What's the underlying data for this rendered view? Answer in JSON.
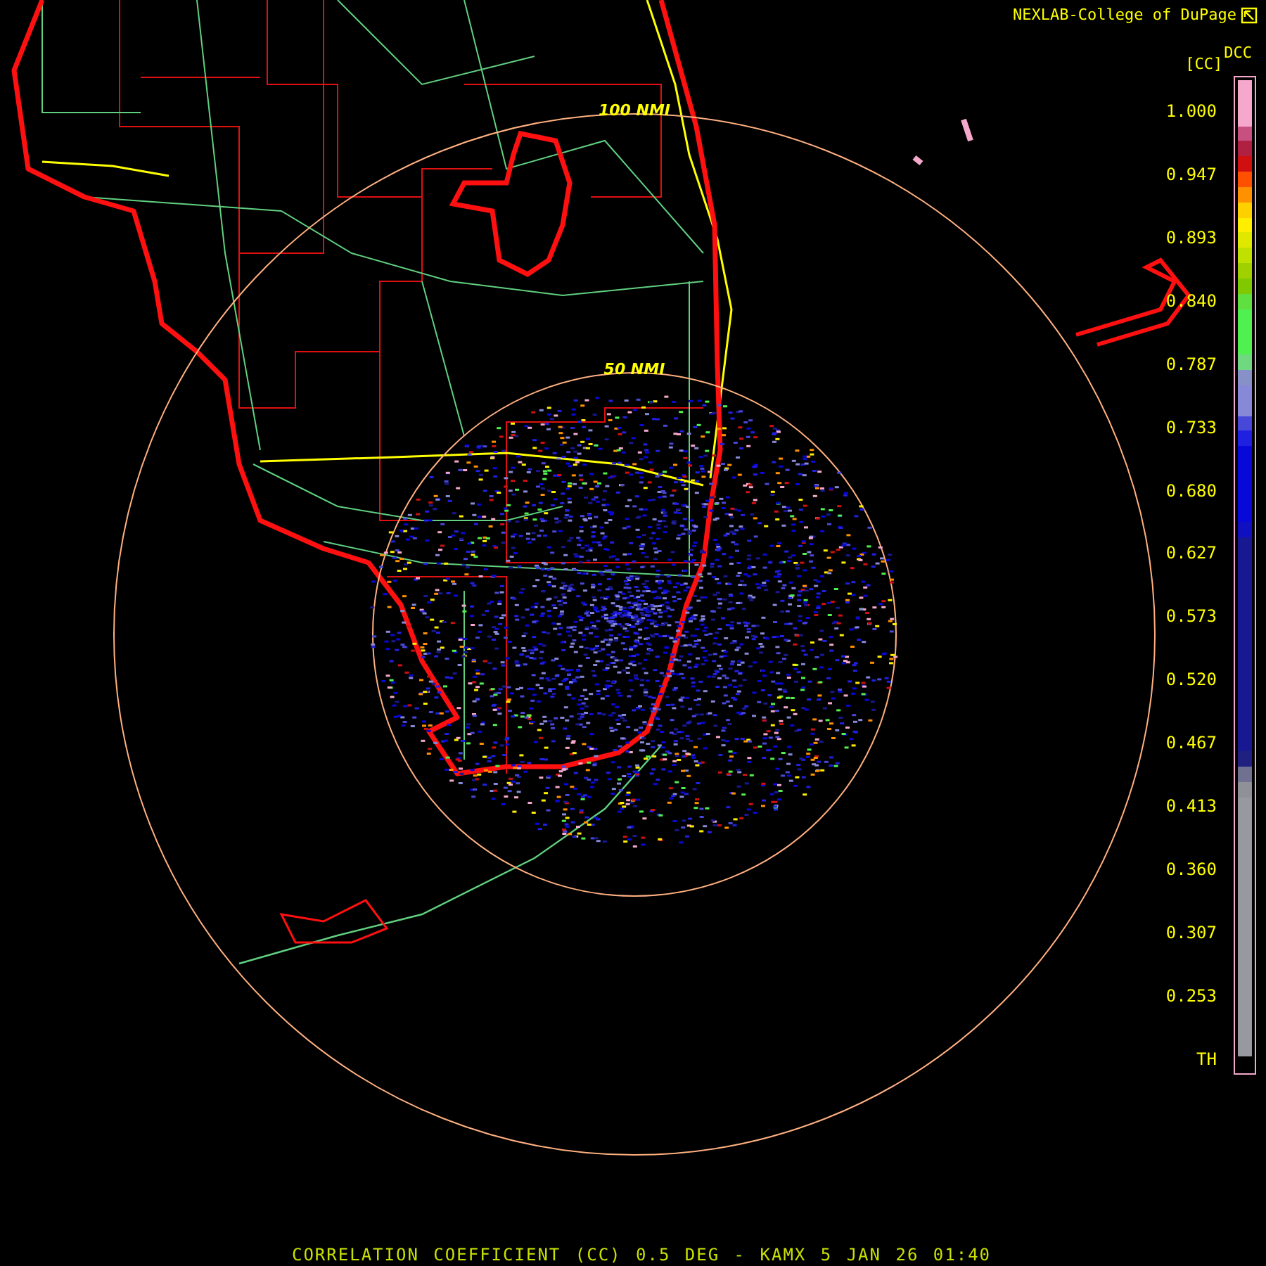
{
  "header": {
    "credit": "NEXLAB-College of DuPage"
  },
  "map": {
    "rings": [
      {
        "label": "100 NMI"
      },
      {
        "label": "50 NMI"
      }
    ]
  },
  "legend": {
    "product": "DCC",
    "unit": "[CC]",
    "labels": [
      "1.000",
      "0.947",
      "0.893",
      "0.840",
      "0.787",
      "0.733",
      "0.680",
      "0.627",
      "0.573",
      "0.520",
      "0.467",
      "0.413",
      "0.360",
      "0.307",
      "0.253",
      "TH"
    ],
    "segments": [
      {
        "color": "#f5a8cc"
      },
      {
        "color": "#f5a8cc"
      },
      {
        "color": "#f5a8cc"
      },
      {
        "color": "#c85080"
      },
      {
        "color": "#b02040"
      },
      {
        "color": "#d01010"
      },
      {
        "color": "#ff5000"
      },
      {
        "color": "#ff9000"
      },
      {
        "color": "#ffd000"
      },
      {
        "color": "#ffee00"
      },
      {
        "color": "#e0e800"
      },
      {
        "color": "#c0e000"
      },
      {
        "color": "#a0d000"
      },
      {
        "color": "#80c800"
      },
      {
        "color": "#60e040"
      },
      {
        "color": "#50f050"
      },
      {
        "color": "#50f050"
      },
      {
        "color": "#50f050"
      },
      {
        "color": "#70d880"
      },
      {
        "color": "#8890c8"
      },
      {
        "color": "#8888d8"
      },
      {
        "color": "#8888d8"
      },
      {
        "color": "#4848d8"
      },
      {
        "color": "#2020e0"
      },
      {
        "color": "#0808d8"
      },
      {
        "color": "#0808d8"
      },
      {
        "color": "#0808d8"
      },
      {
        "color": "#0808d8"
      },
      {
        "color": "#0808d8"
      },
      {
        "color": "#1010c0"
      },
      {
        "color": "#181890"
      },
      {
        "color": "#181890"
      },
      {
        "color": "#181890"
      },
      {
        "color": "#181890"
      },
      {
        "color": "#181890"
      },
      {
        "color": "#181890"
      },
      {
        "color": "#181890"
      },
      {
        "color": "#181890"
      },
      {
        "color": "#181890"
      },
      {
        "color": "#181890"
      },
      {
        "color": "#181890"
      },
      {
        "color": "#181890"
      },
      {
        "color": "#181890"
      },
      {
        "color": "#181890"
      },
      {
        "color": "#202080"
      },
      {
        "color": "#707090"
      },
      {
        "color": "#909098"
      },
      {
        "color": "#9898a0"
      },
      {
        "color": "#9898a0"
      },
      {
        "color": "#9898a0"
      },
      {
        "color": "#9898a0"
      },
      {
        "color": "#9898a0"
      },
      {
        "color": "#9898a0"
      },
      {
        "color": "#9898a0"
      },
      {
        "color": "#9898a0"
      },
      {
        "color": "#9898a0"
      },
      {
        "color": "#9898a0"
      },
      {
        "color": "#9898a0"
      },
      {
        "color": "#9898a0"
      },
      {
        "color": "#9898a0"
      },
      {
        "color": "#9898a0"
      },
      {
        "color": "#9898a0"
      },
      {
        "color": "#9898a0"
      },
      {
        "color": "#9898a0"
      }
    ]
  },
  "caption": "CORRELATION COEFFICIENT (CC) 0.5 DEG - KAMX 5 JAN 26 01:40"
}
